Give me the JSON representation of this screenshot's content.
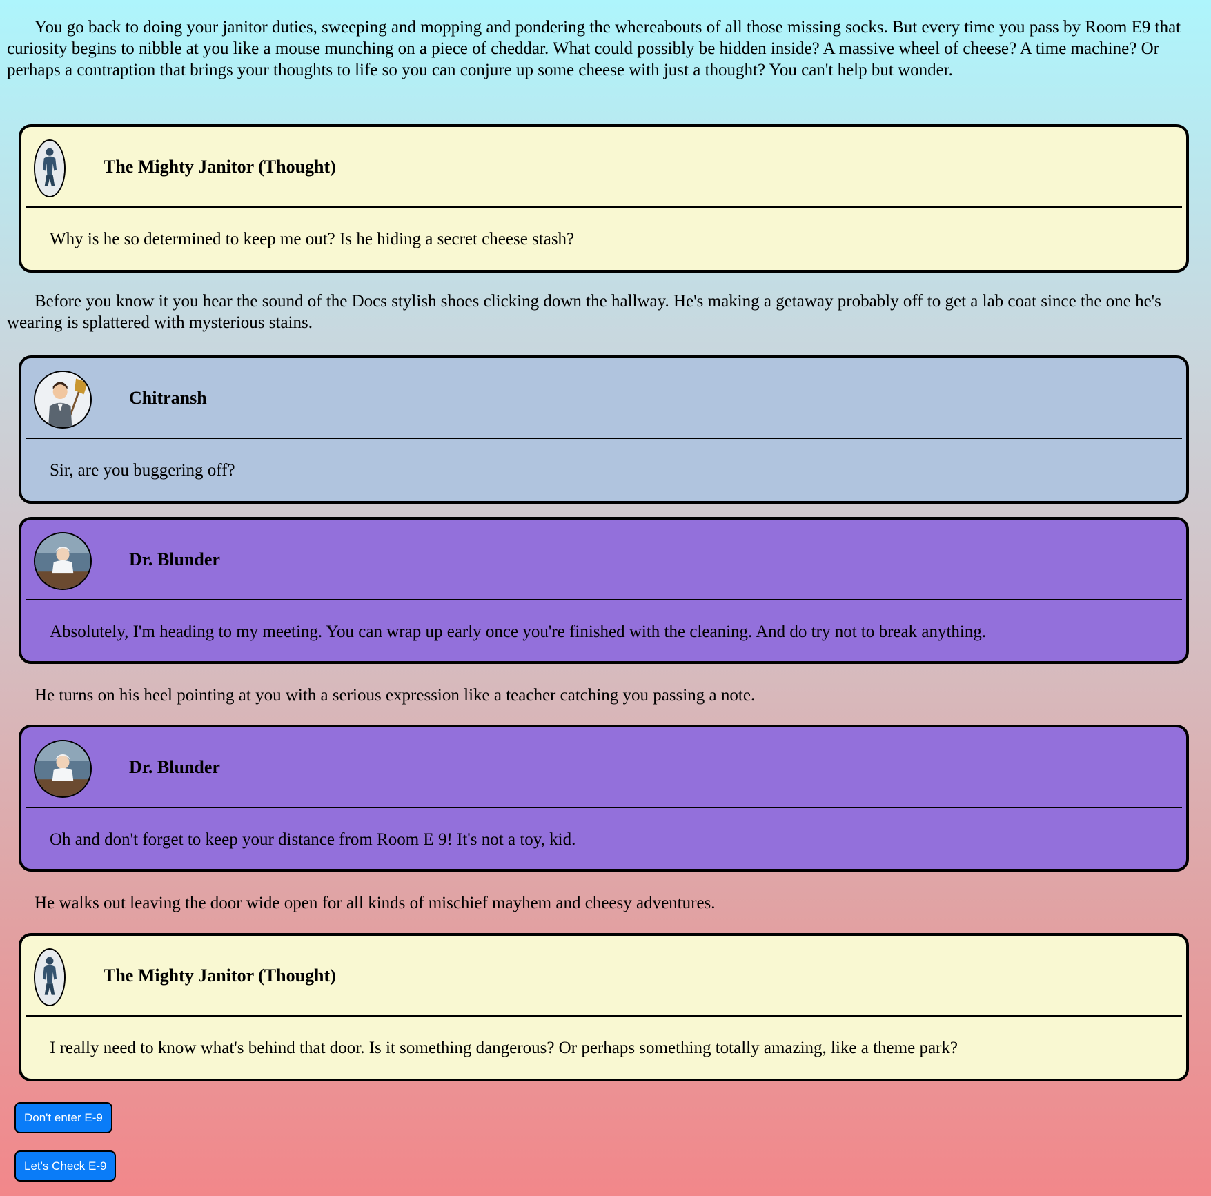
{
  "story": {
    "narration_1": "You go back to doing your janitor duties, sweeping and mopping and pondering the whereabouts of all those missing socks. But every time you pass by Room E9 that curiosity begins to nibble at you like a mouse munching on a piece of cheddar. What could possibly be hidden inside? A massive wheel of cheese? A time machine? Or perhaps a contraption that brings your thoughts to life so you can conjure up some cheese with just a thought? You can't help but wonder.",
    "narration_2": "Before you know it you hear the sound of the Docs stylish shoes clicking down the hallway. He's making a getaway probably off to get a lab coat since the one he's wearing is splattered with mysterious stains.",
    "narration_3": "He turns on his heel pointing at you with a serious expression like a teacher catching you passing a note.",
    "narration_4": "He walks out leaving the door wide open for all kinds of mischief mayhem and cheesy adventures."
  },
  "dialogues": [
    {
      "speaker": "The Mighty Janitor (Thought)",
      "text": "Why is he so determined to keep me out? Is he hiding a secret cheese stash?",
      "color": "#f9f8d2",
      "avatar_icon": "janitor-statue-avatar"
    },
    {
      "speaker": "Chitransh",
      "text": "Sir, are you buggering off?",
      "color": "#b0c4de",
      "avatar_icon": "chitransh-broom-avatar"
    },
    {
      "speaker": "Dr. Blunder",
      "text": "Absolutely, I'm heading to my meeting. You can wrap up early once you're finished with the cleaning. And do try not to break anything.",
      "color": "#9370db",
      "avatar_icon": "dr-blunder-avatar"
    },
    {
      "speaker": "Dr. Blunder",
      "text": "Oh and don't forget to keep your distance from Room E 9! It's not a toy, kid.",
      "color": "#9370db",
      "avatar_icon": "dr-blunder-avatar"
    },
    {
      "speaker": "The Mighty Janitor (Thought)",
      "text": "I really need to know what's behind that door. Is it something dangerous? Or perhaps something totally amazing, like a theme park?",
      "color": "#f9f8d2",
      "avatar_icon": "janitor-statue-avatar"
    }
  ],
  "choices": [
    {
      "label": "Don't enter E-9",
      "color": "#0a7cf8"
    },
    {
      "label": "Let's Check E-9",
      "color": "#0a7cf8"
    }
  ]
}
